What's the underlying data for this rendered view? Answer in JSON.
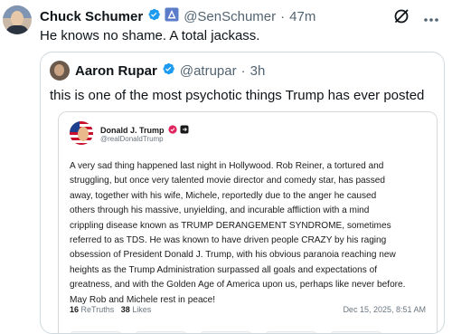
{
  "tweet": {
    "author_name": "Chuck Schumer",
    "author_handle": "@SenSchumer",
    "separator": "·",
    "time": "47m",
    "text": "He knows no shame. A total jackass."
  },
  "quoted": {
    "author_name": "Aaron Rupar",
    "author_handle": "@atrupar",
    "separator": "·",
    "time": "3h",
    "text": "this is one of the most psychotic things Trump has ever posted"
  },
  "embedded_post": {
    "author_name": "Donald J. Trump",
    "author_handle": "@realDonaldTrump",
    "body_lines": [
      "A very sad thing happened last night in Hollywood. Rob Reiner, a tortured and",
      "struggling, but once very talented movie director and comedy star, has passed",
      "away, together with his wife, Michele, reportedly due to the anger he caused",
      "others through his massive, unyielding, and incurable affliction with a mind",
      "crippling disease known as TRUMP DERANGEMENT SYNDROME, sometimes",
      "referred to as TDS. He was known to have driven people CRAZY by his raging",
      "obsession of President Donald J. Trump, with his obvious paranoia reaching new",
      "heights as the Trump Administration surpassed all goals and expectations of",
      "greatness, and with the Golden Age of America upon us, perhaps like never before.",
      "May Rob and Michele rest in peace!"
    ],
    "retruths_count": "16",
    "retruths_label": "ReTruths",
    "likes_count": "38",
    "likes_label": "Likes",
    "date": "Dec 15, 2025, 8:51 AM"
  },
  "colors": {
    "verified_blue": "#1d9bf0",
    "gov_badge": "#829aab",
    "app_badge_purple": "#6e56cf",
    "border": "#cfd9de",
    "secondary_text": "#536471"
  },
  "icons": {
    "grok": "grok-icon",
    "more": "more-options-icon"
  }
}
